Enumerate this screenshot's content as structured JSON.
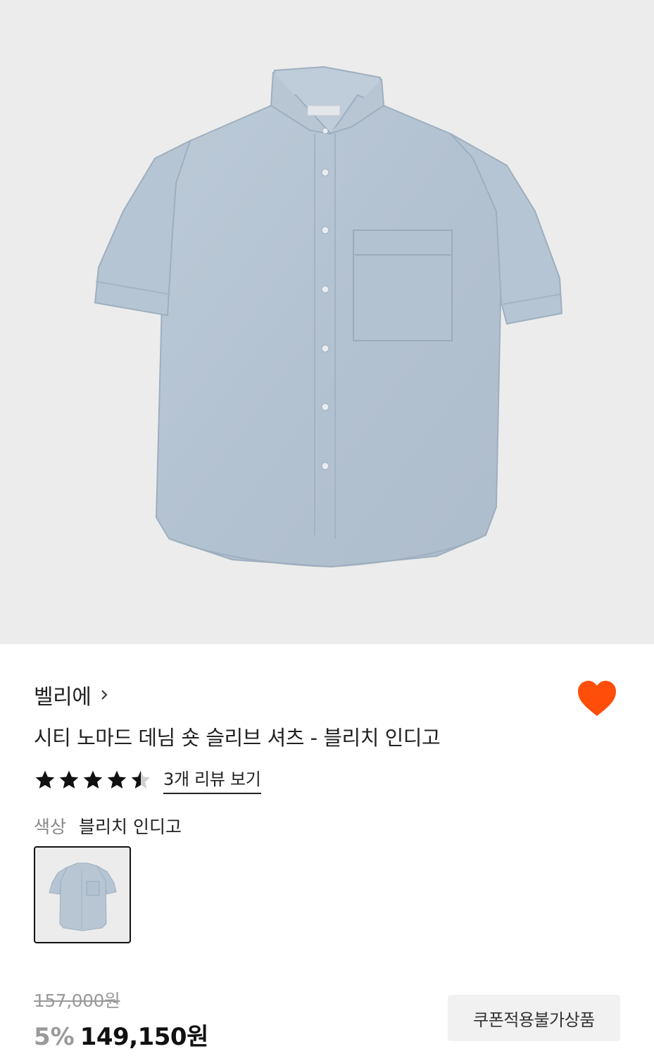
{
  "product_image": {
    "alt": ""
  },
  "brand": {
    "name": "벨리에"
  },
  "product": {
    "title": "시티 노마드 데님 숏 슬리브 셔츠 - 블리치 인디고",
    "rating": 4.5,
    "review_link": "3개 리뷰 보기"
  },
  "color": {
    "label": "색상",
    "value": "블리치 인디고"
  },
  "price": {
    "original": "157,000원",
    "discount": "5%",
    "sale": "149,150원"
  },
  "coupon_badge": "쿠폰적용불가상품",
  "colors": {
    "like_heart": "#ff4d0a",
    "shirt": "#b8c6d4"
  },
  "icons": {
    "brand_arrow": "chevron-right-icon",
    "like": "heart-icon",
    "star": "star-icon"
  }
}
